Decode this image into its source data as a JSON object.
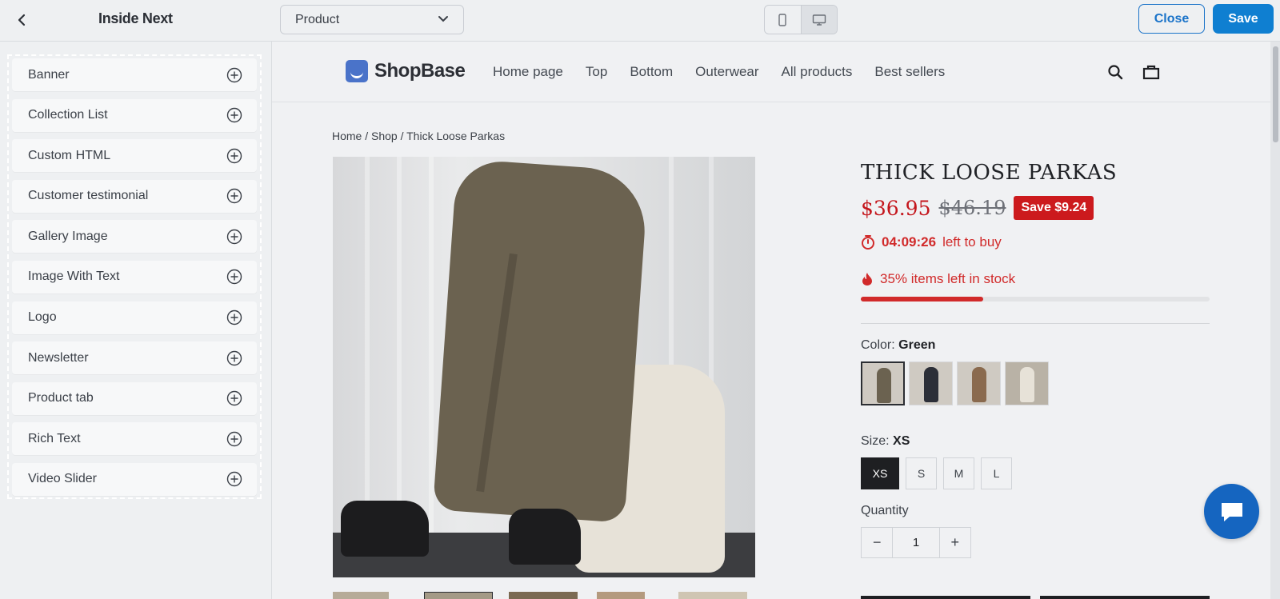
{
  "topbar": {
    "back_icon": "chevron-left-icon",
    "title": "Inside Next",
    "page_select": {
      "value": "Product",
      "icon": "chevron-down-icon"
    },
    "device_toggle": {
      "mobile_icon": "mobile-icon",
      "desktop_icon": "desktop-icon",
      "active": "desktop"
    },
    "close_label": "Close",
    "save_label": "Save",
    "accent_color": "#0f7fd1"
  },
  "sidebar": {
    "sections": [
      {
        "label": "Banner",
        "icon": "add-circle-icon"
      },
      {
        "label": "Collection List",
        "icon": "add-circle-icon"
      },
      {
        "label": "Custom HTML",
        "icon": "add-circle-icon"
      },
      {
        "label": "Customer testimonial",
        "icon": "add-circle-icon"
      },
      {
        "label": "Gallery Image",
        "icon": "add-circle-icon"
      },
      {
        "label": "Image With Text",
        "icon": "add-circle-icon"
      },
      {
        "label": "Logo",
        "icon": "add-circle-icon"
      },
      {
        "label": "Newsletter",
        "icon": "add-circle-icon"
      },
      {
        "label": "Product tab",
        "icon": "add-circle-icon"
      },
      {
        "label": "Rich Text",
        "icon": "add-circle-icon"
      },
      {
        "label": "Video Slider",
        "icon": "add-circle-icon"
      }
    ]
  },
  "store": {
    "logo_text": "ShopBase",
    "nav": [
      "Home page",
      "Top",
      "Bottom",
      "Outerwear",
      "All products",
      "Best sellers"
    ],
    "header_icons": [
      "search-icon",
      "cart-icon"
    ],
    "breadcrumb": "Home / Shop / Thick Loose Parkas",
    "product": {
      "title": "THICK LOOSE PARKAS",
      "price": "$36.95",
      "compare_price": "$46.19",
      "save_badge": "Save $9.24",
      "timer": "04:09:26",
      "timer_suffix": "left to buy",
      "stock_text": "35% items left in stock",
      "stock_fraction": 0.35,
      "color_label": "Color:",
      "color_value": "Green",
      "swatch_colors": [
        "#6b6250",
        "#2c2f38",
        "#8a6a4e",
        "#e7e2d8"
      ],
      "size_label": "Size:",
      "size_value": "XS",
      "sizes": [
        "XS",
        "S",
        "M",
        "L"
      ],
      "quantity_label": "Quantity",
      "quantity": "1",
      "qty_minus": "−",
      "qty_plus": "+"
    },
    "price_color": "#c4161c",
    "chat_icon": "chat-bubble-icon"
  }
}
